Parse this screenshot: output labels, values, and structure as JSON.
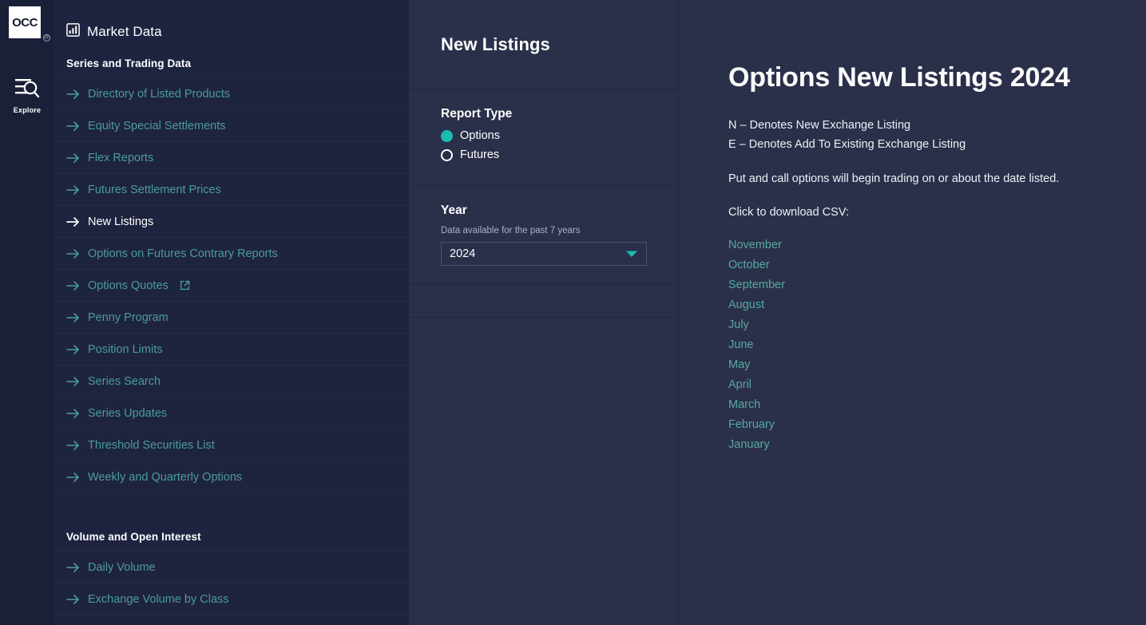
{
  "rail": {
    "logo_text": "OCC",
    "logo_registered": "®",
    "explore_label": "Explore",
    "explore_icon": "menu-search-icon"
  },
  "sidebar": {
    "header_icon": "bar-chart-icon",
    "header_title": "Market Data",
    "groups": [
      {
        "title": "Series and Trading Data",
        "items": [
          {
            "label": "Directory of Listed Products",
            "active": false,
            "external": false
          },
          {
            "label": "Equity Special Settlements",
            "active": false,
            "external": false
          },
          {
            "label": "Flex Reports",
            "active": false,
            "external": false
          },
          {
            "label": "Futures Settlement Prices",
            "active": false,
            "external": false
          },
          {
            "label": "New Listings",
            "active": true,
            "external": false
          },
          {
            "label": "Options on Futures Contrary Reports",
            "active": false,
            "external": false
          },
          {
            "label": "Options Quotes",
            "active": false,
            "external": true
          },
          {
            "label": "Penny Program",
            "active": false,
            "external": false
          },
          {
            "label": "Position Limits",
            "active": false,
            "external": false
          },
          {
            "label": "Series Search",
            "active": false,
            "external": false
          },
          {
            "label": "Series Updates",
            "active": false,
            "external": false
          },
          {
            "label": "Threshold Securities List",
            "active": false,
            "external": false
          },
          {
            "label": "Weekly and Quarterly Options",
            "active": false,
            "external": false
          }
        ]
      },
      {
        "title": "Volume and Open Interest",
        "items": [
          {
            "label": "Daily Volume",
            "active": false,
            "external": false
          },
          {
            "label": "Exchange Volume by Class",
            "active": false,
            "external": false
          }
        ]
      }
    ]
  },
  "panel": {
    "title": "New Listings",
    "report_type": {
      "label": "Report Type",
      "options": [
        {
          "label": "Options",
          "selected": true
        },
        {
          "label": "Futures",
          "selected": false
        }
      ]
    },
    "year": {
      "label": "Year",
      "helper": "Data available for the past 7 years",
      "selected": "2024",
      "caret_icon": "chevron-down-icon"
    }
  },
  "main": {
    "title": "Options New Listings 2024",
    "legend_new": "N – Denotes New Exchange Listing",
    "legend_existing": "E – Denotes Add To Existing Exchange Listing",
    "note": "Put and call options will begin trading on or about the date listed.",
    "download_prompt": "Click to download CSV:",
    "months": [
      "November",
      "October",
      "September",
      "August",
      "July",
      "June",
      "May",
      "April",
      "March",
      "February",
      "January"
    ]
  },
  "colors": {
    "accent_teal": "#1bbdb0",
    "link_teal": "#4a9c97",
    "sidebar_bg": "#1e2340",
    "panel_bg": "#2a3049",
    "rail_bg": "#1b2039"
  }
}
